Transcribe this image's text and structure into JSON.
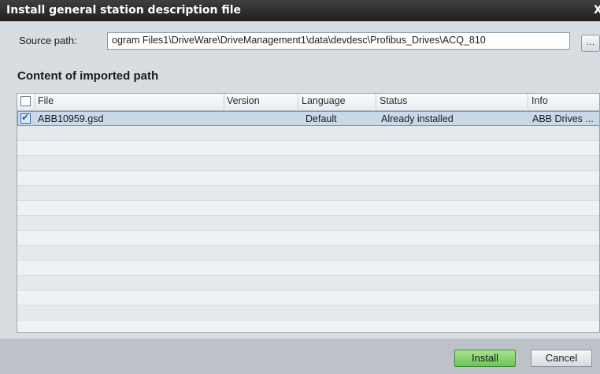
{
  "dialog": {
    "title": "Install general station description file",
    "close_glyph": "X"
  },
  "source": {
    "label": "Source path:",
    "value": "ogram Files1\\DriveWare\\DriveManagement1\\data\\devdesc\\Profibus_Drives\\ACQ_810",
    "browse_label": "..."
  },
  "content": {
    "title": "Content of imported path"
  },
  "table": {
    "columns": [
      "File",
      "Version",
      "Language",
      "Status",
      "Info"
    ],
    "rows": [
      {
        "checked": true,
        "file": "ABB10959.gsd",
        "version": "",
        "language": "Default",
        "status": "Already installed",
        "info": "ABB Drives ..."
      }
    ]
  },
  "buttons": {
    "install": "Install",
    "cancel": "Cancel"
  }
}
